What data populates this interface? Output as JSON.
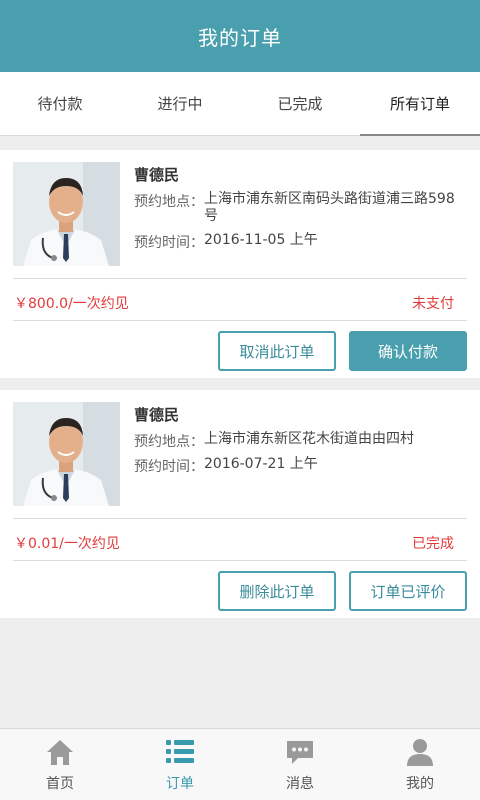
{
  "header": {
    "title": "我的订单"
  },
  "tabs": [
    {
      "label": "待付款"
    },
    {
      "label": "进行中"
    },
    {
      "label": "已完成"
    },
    {
      "label": "所有订单"
    }
  ],
  "orders": [
    {
      "doctor_name": "曹德民",
      "address_label": "预约地点：",
      "address": "上海市浦东新区南码头路街道浦三路598号",
      "time_label": "预约时间：",
      "time": "2016-11-05 上午",
      "price": "￥800.0/一次约见",
      "status": "未支付",
      "btn_left": "取消此订单",
      "btn_right": "确认付款"
    },
    {
      "doctor_name": "曹德民",
      "address_label": "预约地点：",
      "address": "上海市浦东新区花木街道由由四村",
      "time_label": "预约时间：",
      "time": "2016-07-21 上午",
      "price": "￥0.01/一次约见",
      "status": "已完成",
      "btn_left": "删除此订单",
      "btn_right": "订单已评价"
    }
  ],
  "tabbar": [
    {
      "label": "首页",
      "icon": "home-icon"
    },
    {
      "label": "订单",
      "icon": "list-icon"
    },
    {
      "label": "消息",
      "icon": "message-icon"
    },
    {
      "label": "我的",
      "icon": "user-icon"
    }
  ],
  "colors": {
    "accent": "#4a9fae",
    "price": "#e33b3b",
    "active_tab": "#3a9aad"
  }
}
